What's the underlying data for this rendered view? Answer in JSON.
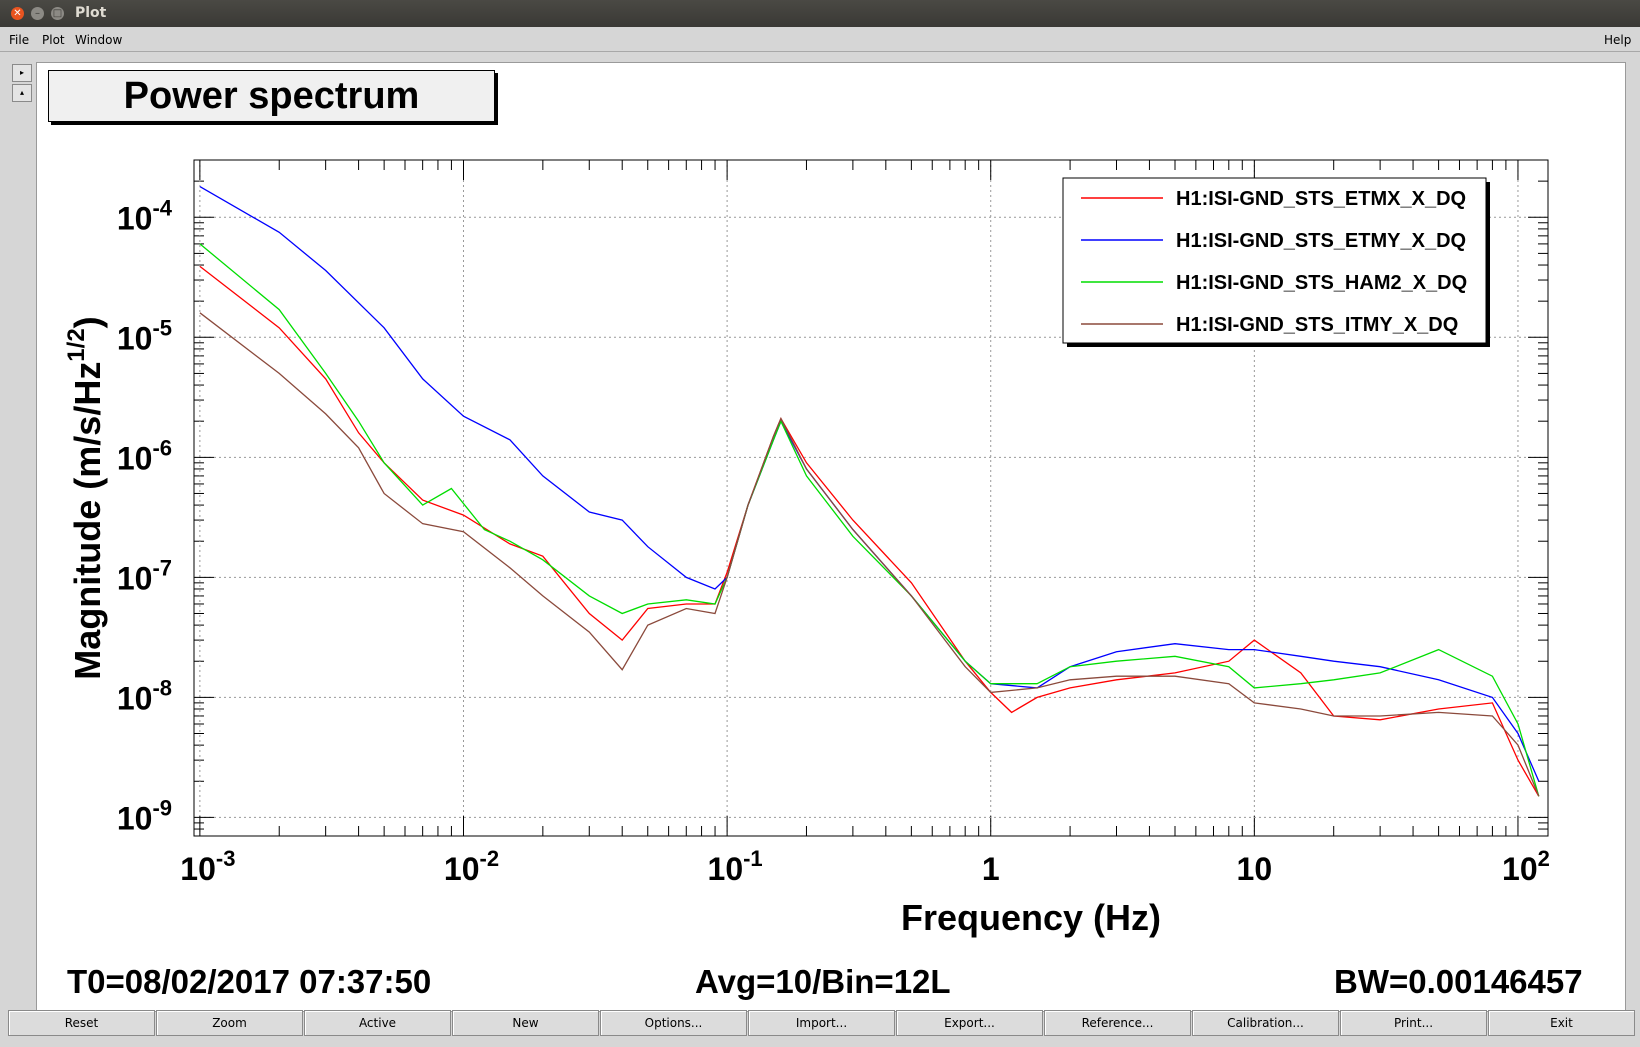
{
  "window": {
    "title": "Plot"
  },
  "menus": {
    "file": "File",
    "plot": "Plot",
    "window": "Window",
    "help": "Help"
  },
  "side_buttons": {
    "next": "▸",
    "prev": "▴"
  },
  "buttons": [
    "Reset",
    "Zoom",
    "Active",
    "New",
    "Options...",
    "Import...",
    "Export...",
    "Reference...",
    "Calibration...",
    "Print...",
    "Exit"
  ],
  "footer": {
    "t0": "T0=08/02/2017 07:37:50",
    "avg": "Avg=10/Bin=12L",
    "bw": "BW=0.00146457"
  },
  "colors": {
    "etmx": "#ff0000",
    "etmy": "#0000ff",
    "ham2": "#00dd00",
    "itmy": "#8b4a3c"
  },
  "chart_data": {
    "type": "line",
    "title": "Power spectrum",
    "xlabel": "Frequency (Hz)",
    "ylabel": "Magnitude (m/s/Hz^1/2)",
    "xscale": "log",
    "yscale": "log",
    "xlim": [
      0.00095,
      130
    ],
    "ylim": [
      7e-10,
      0.0003
    ],
    "grid": true,
    "legend_position": "top-right",
    "x_ticks": [
      "10^-3",
      "10^-2",
      "10^-1",
      "1",
      "10",
      "10^2"
    ],
    "y_ticks": [
      "10^-9",
      "10^-8",
      "10^-7",
      "10^-6",
      "10^-5",
      "10^-4"
    ],
    "series": [
      {
        "name": "H1:ISI-GND_STS_ETMX_X_DQ",
        "color": "#ff0000",
        "points": [
          [
            0.001,
            3.9e-05
          ],
          [
            0.002,
            1.2e-05
          ],
          [
            0.003,
            4.5e-06
          ],
          [
            0.004,
            1.6e-06
          ],
          [
            0.005,
            9e-07
          ],
          [
            0.007,
            4.4e-07
          ],
          [
            0.01,
            3.3e-07
          ],
          [
            0.015,
            1.9e-07
          ],
          [
            0.02,
            1.5e-07
          ],
          [
            0.03,
            5e-08
          ],
          [
            0.04,
            3e-08
          ],
          [
            0.05,
            5.5e-08
          ],
          [
            0.07,
            6e-08
          ],
          [
            0.09,
            6e-08
          ],
          [
            0.1,
            1.1e-07
          ],
          [
            0.12,
            4e-07
          ],
          [
            0.15,
            1.5e-06
          ],
          [
            0.16,
            2.1e-06
          ],
          [
            0.2,
            9e-07
          ],
          [
            0.3,
            3e-07
          ],
          [
            0.5,
            9e-08
          ],
          [
            0.8,
            2e-08
          ],
          [
            1.0,
            1.1e-08
          ],
          [
            1.2,
            7.5e-09
          ],
          [
            1.5,
            1e-08
          ],
          [
            2,
            1.2e-08
          ],
          [
            3,
            1.4e-08
          ],
          [
            5,
            1.6e-08
          ],
          [
            8,
            2e-08
          ],
          [
            10,
            3e-08
          ],
          [
            15,
            1.6e-08
          ],
          [
            20,
            7e-09
          ],
          [
            30,
            6.5e-09
          ],
          [
            50,
            8e-09
          ],
          [
            80,
            9e-09
          ],
          [
            100,
            3e-09
          ],
          [
            120,
            1.5e-09
          ]
        ]
      },
      {
        "name": "H1:ISI-GND_STS_ETMY_X_DQ",
        "color": "#0000ff",
        "points": [
          [
            0.001,
            0.00018
          ],
          [
            0.002,
            7.5e-05
          ],
          [
            0.003,
            3.6e-05
          ],
          [
            0.005,
            1.2e-05
          ],
          [
            0.007,
            4.5e-06
          ],
          [
            0.01,
            2.2e-06
          ],
          [
            0.015,
            1.4e-06
          ],
          [
            0.02,
            7e-07
          ],
          [
            0.03,
            3.5e-07
          ],
          [
            0.04,
            3e-07
          ],
          [
            0.05,
            1.8e-07
          ],
          [
            0.07,
            1e-07
          ],
          [
            0.09,
            8e-08
          ],
          [
            0.1,
            1e-07
          ],
          [
            0.12,
            4e-07
          ],
          [
            0.15,
            1.4e-06
          ],
          [
            0.16,
            2e-06
          ],
          [
            0.2,
            8e-07
          ],
          [
            0.3,
            2.5e-07
          ],
          [
            0.5,
            7e-08
          ],
          [
            0.8,
            2e-08
          ],
          [
            1.0,
            1.3e-08
          ],
          [
            1.5,
            1.2e-08
          ],
          [
            2,
            1.8e-08
          ],
          [
            3,
            2.4e-08
          ],
          [
            5,
            2.8e-08
          ],
          [
            8,
            2.5e-08
          ],
          [
            10,
            2.5e-08
          ],
          [
            15,
            2.2e-08
          ],
          [
            20,
            2e-08
          ],
          [
            30,
            1.8e-08
          ],
          [
            50,
            1.4e-08
          ],
          [
            80,
            1e-08
          ],
          [
            100,
            5e-09
          ],
          [
            120,
            2e-09
          ]
        ]
      },
      {
        "name": "H1:ISI-GND_STS_HAM2_X_DQ",
        "color": "#00dd00",
        "points": [
          [
            0.001,
            6e-05
          ],
          [
            0.002,
            1.7e-05
          ],
          [
            0.003,
            5e-06
          ],
          [
            0.004,
            2e-06
          ],
          [
            0.005,
            9e-07
          ],
          [
            0.007,
            4e-07
          ],
          [
            0.009,
            5.5e-07
          ],
          [
            0.012,
            2.5e-07
          ],
          [
            0.015,
            2e-07
          ],
          [
            0.02,
            1.4e-07
          ],
          [
            0.03,
            7e-08
          ],
          [
            0.04,
            5e-08
          ],
          [
            0.05,
            6e-08
          ],
          [
            0.07,
            6.5e-08
          ],
          [
            0.09,
            6e-08
          ],
          [
            0.1,
            1e-07
          ],
          [
            0.12,
            4e-07
          ],
          [
            0.15,
            1.4e-06
          ],
          [
            0.16,
            2e-06
          ],
          [
            0.2,
            7e-07
          ],
          [
            0.3,
            2.2e-07
          ],
          [
            0.5,
            7e-08
          ],
          [
            0.8,
            2e-08
          ],
          [
            1.0,
            1.3e-08
          ],
          [
            1.5,
            1.3e-08
          ],
          [
            2,
            1.8e-08
          ],
          [
            3,
            2e-08
          ],
          [
            5,
            2.2e-08
          ],
          [
            8,
            1.8e-08
          ],
          [
            10,
            1.2e-08
          ],
          [
            15,
            1.3e-08
          ],
          [
            20,
            1.4e-08
          ],
          [
            30,
            1.6e-08
          ],
          [
            50,
            2.5e-08
          ],
          [
            80,
            1.5e-08
          ],
          [
            100,
            6e-09
          ],
          [
            120,
            1.5e-09
          ]
        ]
      },
      {
        "name": "H1:ISI-GND_STS_ITMY_X_DQ",
        "color": "#8b4a3c",
        "points": [
          [
            0.001,
            1.6e-05
          ],
          [
            0.002,
            5e-06
          ],
          [
            0.003,
            2.3e-06
          ],
          [
            0.004,
            1.2e-06
          ],
          [
            0.005,
            5e-07
          ],
          [
            0.007,
            2.8e-07
          ],
          [
            0.01,
            2.4e-07
          ],
          [
            0.015,
            1.2e-07
          ],
          [
            0.02,
            7e-08
          ],
          [
            0.03,
            3.5e-08
          ],
          [
            0.04,
            1.7e-08
          ],
          [
            0.05,
            4e-08
          ],
          [
            0.07,
            5.5e-08
          ],
          [
            0.09,
            5e-08
          ],
          [
            0.1,
            1e-07
          ],
          [
            0.12,
            4e-07
          ],
          [
            0.15,
            1.5e-06
          ],
          [
            0.16,
            2.1e-06
          ],
          [
            0.2,
            8e-07
          ],
          [
            0.3,
            2.5e-07
          ],
          [
            0.5,
            7e-08
          ],
          [
            0.8,
            1.8e-08
          ],
          [
            1.0,
            1.1e-08
          ],
          [
            1.5,
            1.2e-08
          ],
          [
            2,
            1.4e-08
          ],
          [
            3,
            1.5e-08
          ],
          [
            5,
            1.5e-08
          ],
          [
            8,
            1.3e-08
          ],
          [
            10,
            9e-09
          ],
          [
            15,
            8e-09
          ],
          [
            20,
            7e-09
          ],
          [
            30,
            7e-09
          ],
          [
            50,
            7.5e-09
          ],
          [
            80,
            7e-09
          ],
          [
            100,
            4e-09
          ],
          [
            120,
            1.5e-09
          ]
        ]
      }
    ]
  }
}
